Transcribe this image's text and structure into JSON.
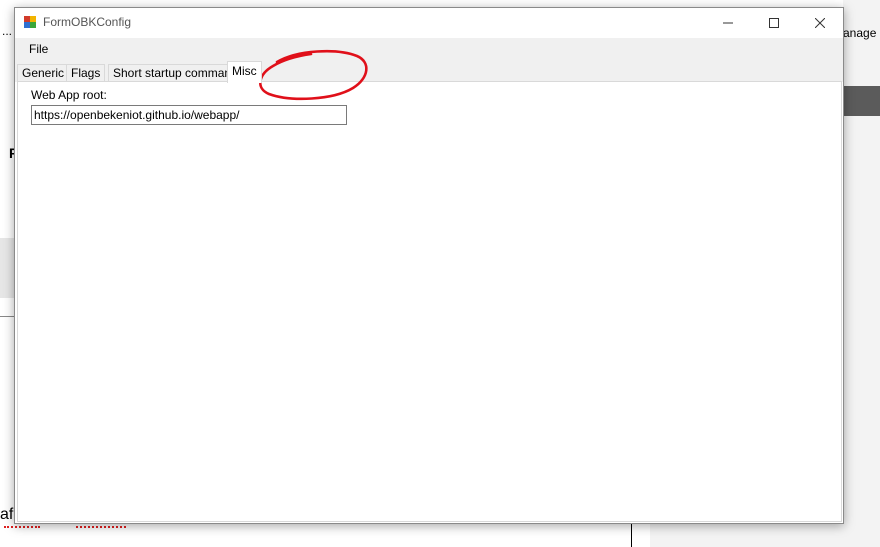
{
  "window": {
    "title": "FormOBKConfig",
    "minimize_glyph": "—",
    "maximize_glyph": "☐",
    "close_glyph": "✕"
  },
  "menu": {
    "file_label": "File"
  },
  "tabs": [
    {
      "label": "Generic",
      "active": false
    },
    {
      "label": "Flags",
      "active": false
    },
    {
      "label": "Short startup command",
      "active": false
    },
    {
      "label": "Misc",
      "active": true
    }
  ],
  "misc": {
    "web_app_root_label": "Web App root:",
    "web_app_root_value": "https://openbekeniot.github.io/webapp/"
  },
  "background": {
    "manage_text": "anage",
    "ellipsis": "...",
    "left_letter": "P",
    "bottom_text": "afi"
  },
  "colors": {
    "annotation_red": "#e0101a"
  }
}
